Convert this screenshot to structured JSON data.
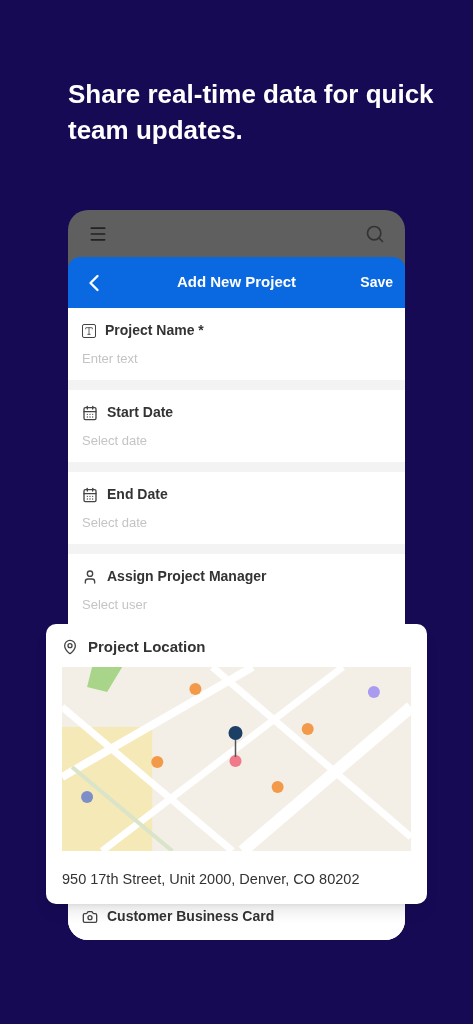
{
  "headline": "Share real-time data for quick team updates.",
  "header": {
    "title": "Add New Project",
    "action": "Save"
  },
  "fields": [
    {
      "kind": "text",
      "label": "Project Name *",
      "placeholder": "Enter text"
    },
    {
      "kind": "date",
      "label": "Start Date",
      "placeholder": "Select date"
    },
    {
      "kind": "date",
      "label": "End Date",
      "placeholder": "Select date"
    },
    {
      "kind": "user",
      "label": "Assign Project Manager",
      "placeholder": "Select user"
    },
    {
      "kind": "camera",
      "label": "Customer Business Card"
    }
  ],
  "location_card": {
    "title": "Project Location",
    "address": "950 17th Street, Unit 2000, Denver, CO 80202"
  }
}
